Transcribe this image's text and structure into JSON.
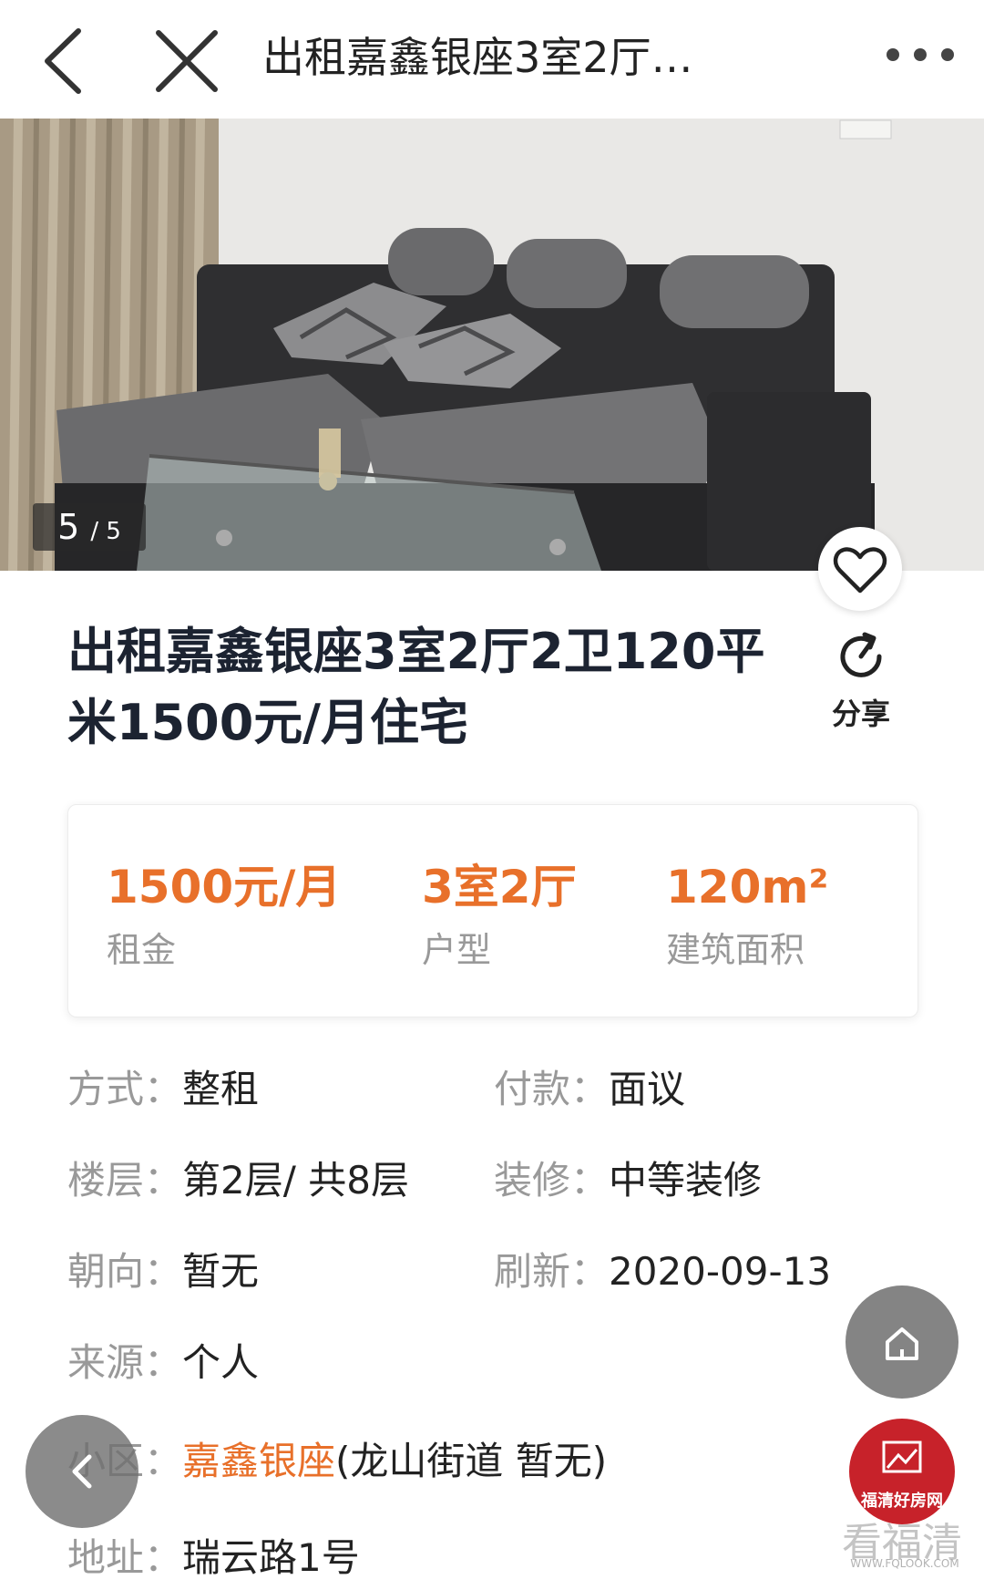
{
  "nav": {
    "title": "出租嘉鑫银座3室2厅…"
  },
  "gallery": {
    "current": "5",
    "total": "/ 5"
  },
  "listing": {
    "title": "出租嘉鑫银座3室2厅2卫120平米1500元/月住宅",
    "share_label": "分享"
  },
  "stats": [
    {
      "value": "1500元/月",
      "label": "租金"
    },
    {
      "value": "3室2厅",
      "label": "户型"
    },
    {
      "value": "120m²",
      "label": "建筑面积"
    }
  ],
  "details": {
    "mode": {
      "key": "方式：",
      "value": "整租"
    },
    "payment": {
      "key": "付款：",
      "value": "面议"
    },
    "floor": {
      "key": "楼层：",
      "value": "第2层/ 共8层"
    },
    "decoration": {
      "key": "装修：",
      "value": "中等装修"
    },
    "orientation": {
      "key": "朝向：",
      "value": "暂无"
    },
    "refresh": {
      "key": "刷新：",
      "value": "2020-09-13"
    },
    "source": {
      "key": "来源：",
      "value": "个人"
    },
    "community": {
      "key": "小区：",
      "value": "嘉鑫银座",
      "extra": "(龙山街道 暂无)"
    },
    "address": {
      "key": "地址：",
      "value": "瑞云路1号"
    }
  },
  "brand": {
    "name": "福清好房网",
    "watermark": "看福清",
    "watermark_url": "WWW.FQLOOK.COM"
  },
  "colors": {
    "accent": "#e8702a",
    "title": "#1c2331",
    "muted": "#999999",
    "brand_red": "#c7222a"
  }
}
